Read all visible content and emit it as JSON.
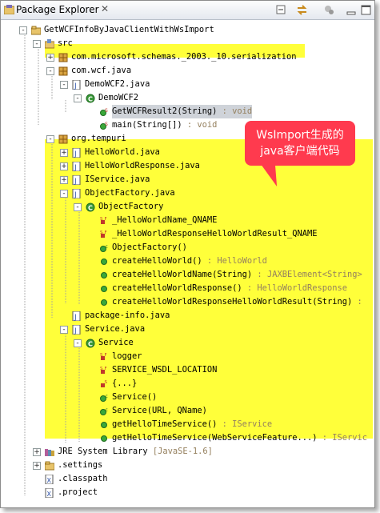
{
  "view": {
    "title": "Package Explorer",
    "close_glyph": "✕"
  },
  "callout": {
    "line1": "WsImport生成的",
    "line2": "java客户端代码"
  },
  "tree": [
    {
      "label": "GetWCFInfoByJavaClientWithWsImport",
      "type": "",
      "icon": "project-icon"
    },
    {
      "label": "src",
      "type": "",
      "icon": "source-folder-icon"
    },
    {
      "label": "com.microsoft.schemas._2003._10.serialization",
      "type": "",
      "icon": "package-icon"
    },
    {
      "label": "com.wcf.java",
      "type": "",
      "icon": "package-icon"
    },
    {
      "label": "DemoWCF2.java",
      "type": "",
      "icon": "java-file-icon"
    },
    {
      "label": "DemoWCF2",
      "type": "",
      "icon": "class-icon"
    },
    {
      "label": "GetWCFResult2(String)",
      "type": " : void",
      "icon": "static-method-icon"
    },
    {
      "label": "main(String[])",
      "type": " : void",
      "icon": "static-method-icon"
    },
    {
      "label": "org.tempuri",
      "type": "",
      "icon": "package-icon"
    },
    {
      "label": "HelloWorld.java",
      "type": "",
      "icon": "java-file-icon"
    },
    {
      "label": "HelloWorldResponse.java",
      "type": "",
      "icon": "java-file-icon"
    },
    {
      "label": "IService.java",
      "type": "",
      "icon": "java-file-icon"
    },
    {
      "label": "ObjectFactory.java",
      "type": "",
      "icon": "java-file-icon"
    },
    {
      "label": "ObjectFactory",
      "type": "",
      "icon": "class-icon"
    },
    {
      "label": "_HelloWorldName_QNAME",
      "type": "",
      "icon": "static-final-field-icon"
    },
    {
      "label": "_HelloWorldResponseHelloWorldResult_QNAME",
      "type": "",
      "icon": "static-final-field-icon"
    },
    {
      "label": "ObjectFactory()",
      "type": "",
      "icon": "constructor-icon"
    },
    {
      "label": "createHelloWorld()",
      "type": " : HelloWorld",
      "icon": "method-icon"
    },
    {
      "label": "createHelloWorldName(String)",
      "type": " : JAXBElement<String>",
      "icon": "method-icon"
    },
    {
      "label": "createHelloWorldResponse()",
      "type": " : HelloWorldResponse",
      "icon": "method-icon"
    },
    {
      "label": "createHelloWorldResponseHelloWorldResult(String)",
      "type": " :",
      "icon": "method-icon"
    },
    {
      "label": "package-info.java",
      "type": "",
      "icon": "java-file-icon"
    },
    {
      "label": "Service.java",
      "type": "",
      "icon": "java-file-icon"
    },
    {
      "label": "Service",
      "type": "",
      "icon": "class-icon"
    },
    {
      "label": "logger",
      "type": "",
      "icon": "static-final-field-icon"
    },
    {
      "label": "SERVICE_WSDL_LOCATION",
      "type": "",
      "icon": "static-final-field-icon"
    },
    {
      "label": "{...}",
      "type": "",
      "icon": "static-initializer-icon"
    },
    {
      "label": "Service()",
      "type": "",
      "icon": "constructor-icon"
    },
    {
      "label": "Service(URL, QName)",
      "type": "",
      "icon": "constructor-icon"
    },
    {
      "label": "getHelloTimeService()",
      "type": " : IService",
      "icon": "method-icon"
    },
    {
      "label": "getHelloTimeService(WebServiceFeature...)",
      "type": " : IServic",
      "icon": "method-icon"
    },
    {
      "label": "JRE System Library",
      "type": " [JavaSE-1.6]",
      "icon": "library-icon"
    },
    {
      "label": ".settings",
      "type": "",
      "icon": "folder-icon"
    },
    {
      "label": ".classpath",
      "type": "",
      "icon": "xml-file-icon"
    },
    {
      "label": ".project",
      "type": "",
      "icon": "xml-file-icon"
    }
  ]
}
